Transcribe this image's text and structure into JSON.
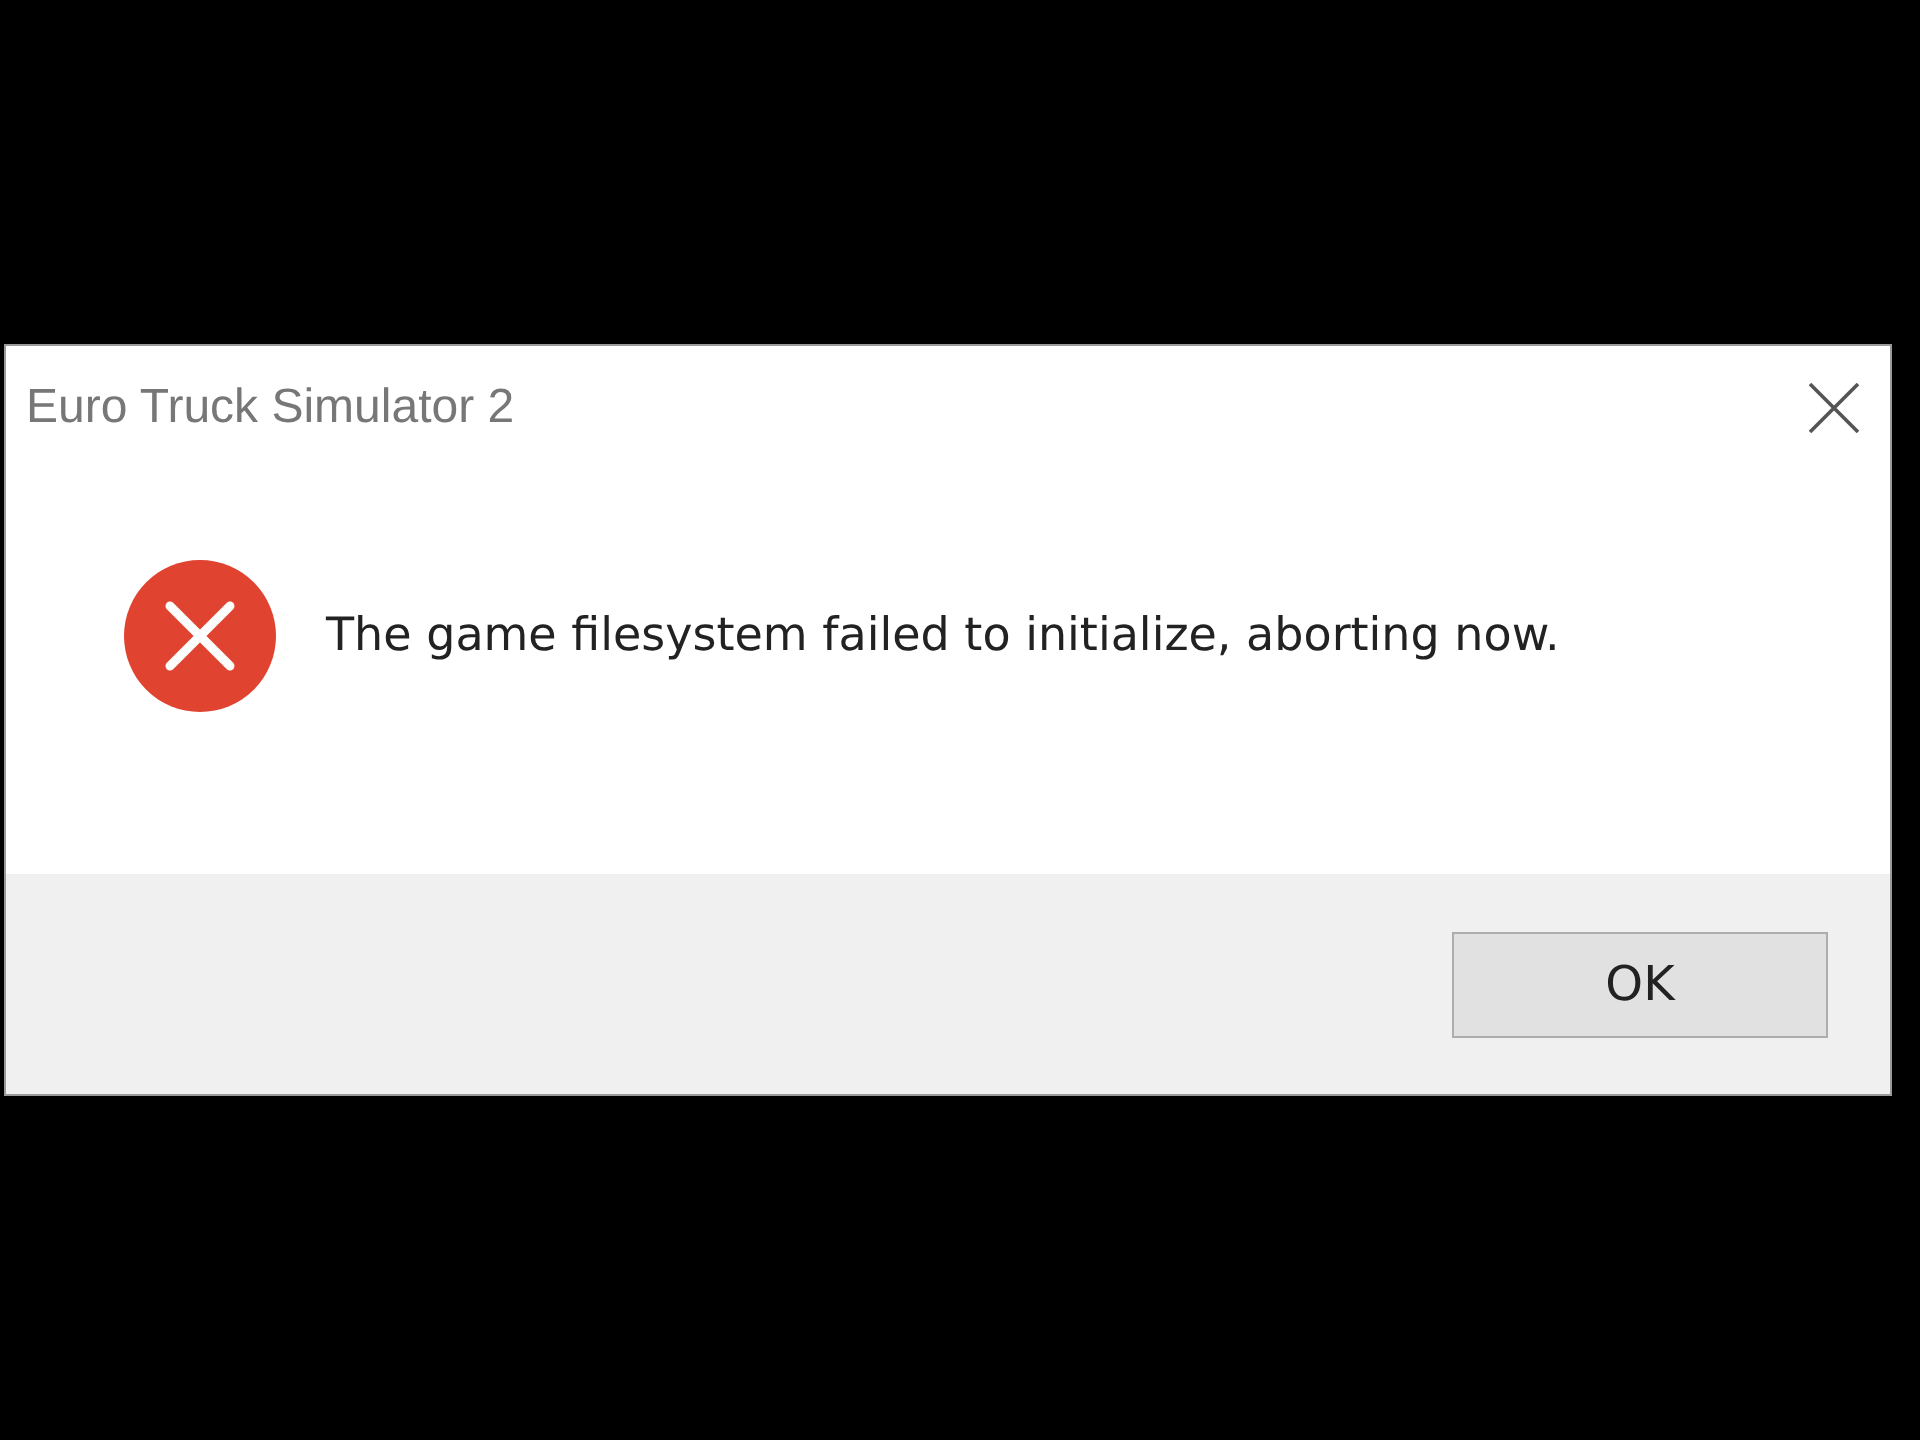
{
  "window": {
    "title": "Euro Truck Simulator 2"
  },
  "message": {
    "kind": "error",
    "text": "The game filesystem failed to initialize, aborting now."
  },
  "buttons": [
    "OK"
  ]
}
